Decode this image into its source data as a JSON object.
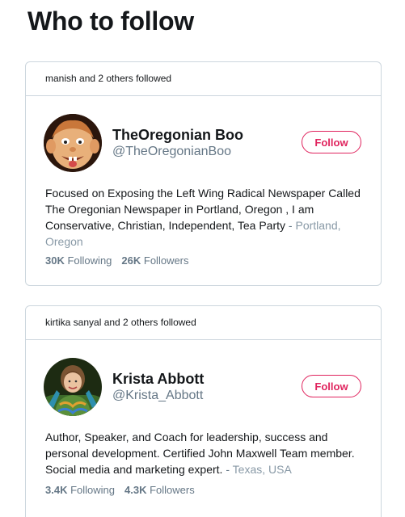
{
  "page": {
    "title": "Who to follow"
  },
  "suggestions": [
    {
      "social_context": "manish and 2 others followed",
      "name": "TheOregonian Boo",
      "handle": "@TheOregonianBoo",
      "follow_label": "Follow",
      "bio": "Focused on Exposing the Left Wing Radical Newspaper Called The Oregonian Newspaper in Portland, Oregon , I am Conservative, Christian, Independent, Tea Party",
      "separator": "-",
      "location": "Portland, Oregon",
      "following_count": "30K",
      "following_label": "Following",
      "followers_count": "26K",
      "followers_label": "Followers",
      "avatar_icon": "cartoon-face-avatar"
    },
    {
      "social_context": "kirtika sanyal and 2 others followed",
      "name": "Krista Abbott",
      "handle": "@Krista_Abbott",
      "follow_label": "Follow",
      "bio": "Author, Speaker, and Coach for leadership, success and personal development. Certified John Maxwell Team member. Social media and marketing expert.",
      "separator": "-",
      "location": "Texas, USA",
      "following_count": "3.4K",
      "following_label": "Following",
      "followers_count": "4.3K",
      "followers_label": "Followers",
      "avatar_icon": "person-photo-avatar"
    }
  ],
  "colors": {
    "accent": "#e0245e",
    "muted": "#657786",
    "border": "#ccd6dd",
    "text": "#14171a"
  }
}
